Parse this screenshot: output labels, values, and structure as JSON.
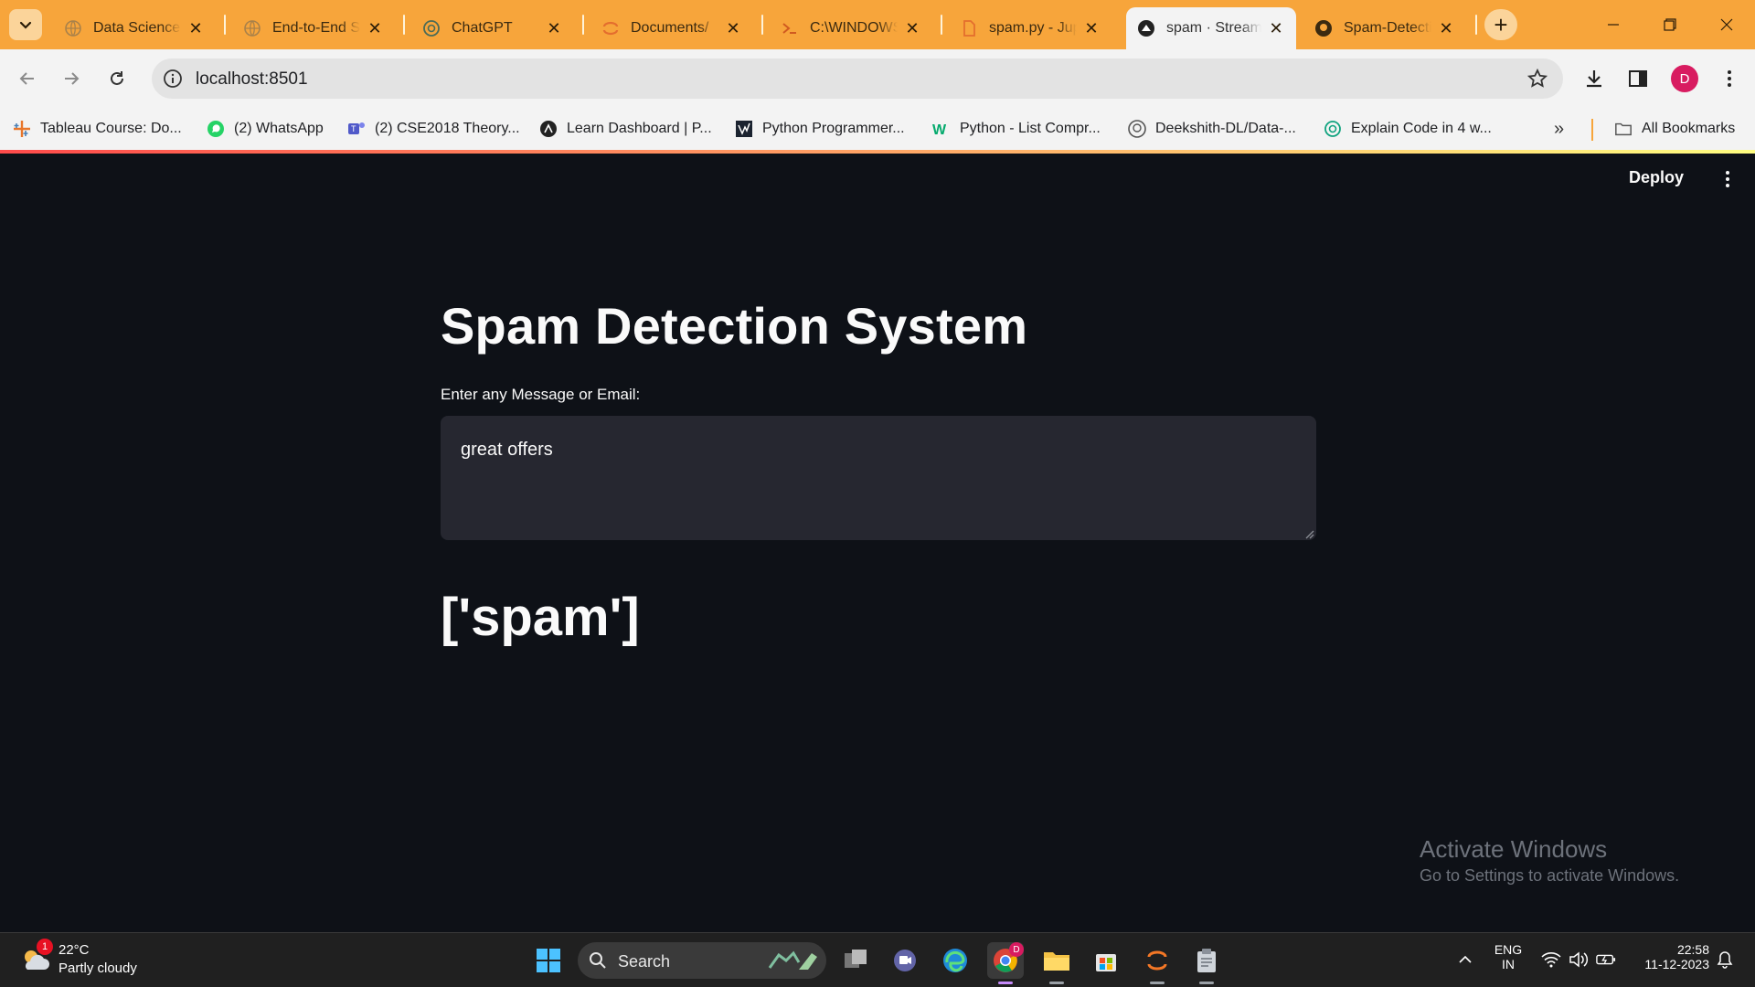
{
  "browser": {
    "tabs": [
      {
        "title": "Data Science",
        "icon": "globe-icon"
      },
      {
        "title": "End-to-End Sp",
        "icon": "globe-icon"
      },
      {
        "title": "ChatGPT",
        "icon": "chatgpt-icon"
      },
      {
        "title": "Documents/",
        "icon": "jupyter-icon"
      },
      {
        "title": "C:\\WINDOWS",
        "icon": "terminal-icon"
      },
      {
        "title": "spam.py - Jup",
        "icon": "file-icon"
      },
      {
        "title": "spam · Stream",
        "icon": "streamlit-icon",
        "active": true
      },
      {
        "title": "Spam-Detecti",
        "icon": "github-icon"
      }
    ],
    "url": "localhost:8501",
    "profile_initial": "D"
  },
  "bookmarks": [
    {
      "label": "Tableau Course: Do...",
      "icon": "tableau-icon"
    },
    {
      "label": "(2) WhatsApp",
      "icon": "whatsapp-icon"
    },
    {
      "label": "(2) CSE2018 Theory...",
      "icon": "teams-icon"
    },
    {
      "label": "Learn Dashboard | P...",
      "icon": "learn-icon"
    },
    {
      "label": "Python Programmer...",
      "icon": "python-programmer-icon"
    },
    {
      "label": "Python - List Compr...",
      "icon": "w3-icon"
    },
    {
      "label": "Deekshith-DL/Data-...",
      "icon": "github-icon"
    },
    {
      "label": "Explain Code in 4 w...",
      "icon": "chatgpt-icon"
    }
  ],
  "bookmarks_all_label": "All Bookmarks",
  "app": {
    "deploy_label": "Deploy",
    "title": "Spam Detection System",
    "input_label": "Enter any Message or Email:",
    "input_value": "great offers",
    "result": "['spam']"
  },
  "watermark": {
    "title": "Activate Windows",
    "subtitle": "Go to Settings to activate Windows."
  },
  "taskbar": {
    "weather_temp": "22°C",
    "weather_condition": "Partly cloudy",
    "weather_badge": "1",
    "search_label": "Search",
    "language_line1": "ENG",
    "language_line2": "IN",
    "time": "22:58",
    "date": "11-12-2023",
    "chrome_badge": "D"
  },
  "colors": {
    "tabstrip": "#f7a53b",
    "app_background": "#0e1117",
    "input_background": "#262730",
    "text": "#fafafa"
  }
}
